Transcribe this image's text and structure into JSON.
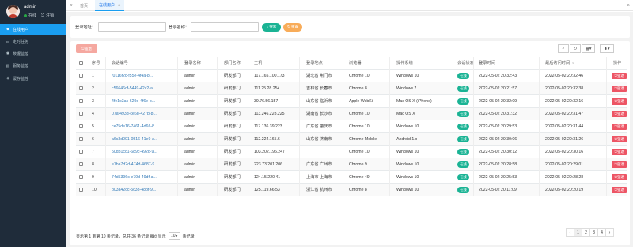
{
  "user": {
    "name": "admin",
    "status": "在线",
    "logout": "注销"
  },
  "sidebar": {
    "items": [
      {
        "label": "在线用户",
        "icon": "user-icon"
      },
      {
        "label": "定时任务",
        "icon": "tasks-icon"
      },
      {
        "label": "数据监控",
        "icon": "bug-icon"
      },
      {
        "label": "服务监控",
        "icon": "server-icon"
      },
      {
        "label": "缓存监控",
        "icon": "cube-icon"
      }
    ]
  },
  "tabs": {
    "home": "首页",
    "active": "在线用户"
  },
  "search": {
    "ip_label": "登录地址：",
    "name_label": "登录名称：",
    "search_btn": "搜索",
    "reset_btn": "重置"
  },
  "toolbar": {
    "kick_btn": "强退"
  },
  "table": {
    "headers": {
      "index": "序号",
      "session": "会话编号",
      "login_name": "登录名称",
      "dept": "部门名称",
      "host": "主机",
      "location": "登录地点",
      "browser": "浏览器",
      "os": "操作系统",
      "status": "会话状态",
      "login_time": "登录时间",
      "last_access": "最后访问时间",
      "action": "操作"
    },
    "rows": [
      {
        "index": "1",
        "session": "f0116f2c-f55e-4f4a-8...",
        "login_name": "admin",
        "dept": "研发部门",
        "host": "117.165.100.173",
        "location": "湖北省 荆门市",
        "browser": "Chrome 10",
        "os": "Windows 10",
        "status": "在线",
        "login_time": "2022-05-02 20:32:43",
        "last_access": "2022-05-02 20:32:46",
        "action": "强退"
      },
      {
        "index": "2",
        "session": "c56646cf-5449-42c2-a...",
        "login_name": "admin",
        "dept": "研发部门",
        "host": "111.25.28.254",
        "location": "吉林省 长春市",
        "browser": "Chrome 8",
        "os": "Windows 7",
        "status": "在线",
        "login_time": "2022-05-02 20:21:57",
        "last_access": "2022-05-02 20:32:38",
        "action": "强退"
      },
      {
        "index": "3",
        "session": "4fe1c3ac-629d-4f6e-b...",
        "login_name": "admin",
        "dept": "研发部门",
        "host": "39.76.56.157",
        "location": "山东省 临沂市",
        "browser": "Apple WebKit",
        "os": "Mac OS X (iPhone)",
        "status": "在线",
        "login_time": "2022-05-02 20:32:09",
        "last_access": "2022-05-02 20:32:16",
        "action": "强退"
      },
      {
        "index": "4",
        "session": "07af493d-ce6d-427b-8...",
        "login_name": "admin",
        "dept": "研发部门",
        "host": "113.246.228.225",
        "location": "湖南省 长沙市",
        "browser": "Chrome 10",
        "os": "Mac OS X",
        "status": "在线",
        "login_time": "2022-05-02 20:31:32",
        "last_access": "2022-05-02 20:31:47",
        "action": "强退"
      },
      {
        "index": "5",
        "session": "ce75de16-7461-4d66-8...",
        "login_name": "admin",
        "dept": "研发部门",
        "host": "117.136.39.223",
        "location": "广东省 肇庆市",
        "browser": "Chrome 10",
        "os": "Windows 10",
        "status": "在线",
        "login_time": "2022-05-02 20:29:53",
        "last_access": "2022-05-02 20:31:44",
        "action": "强退"
      },
      {
        "index": "6",
        "session": "a6c3d001-0516-41e9-a...",
        "login_name": "admin",
        "dept": "研发部门",
        "host": "112.224.165.6",
        "location": "山东省 济南市",
        "browser": "Chrome Mobile",
        "os": "Android 1.x",
        "status": "在线",
        "login_time": "2022-05-02 20:30:06",
        "last_access": "2022-05-02 20:31:26",
        "action": "强退"
      },
      {
        "index": "7",
        "session": "50db1cc1-689c-492d-9...",
        "login_name": "admin",
        "dept": "研发部门",
        "host": "103.202.196.247",
        "location": "",
        "browser": "Chrome 10",
        "os": "Windows 10",
        "status": "在线",
        "login_time": "2022-05-02 20:30:12",
        "last_access": "2022-05-02 20:30:16",
        "action": "强退"
      },
      {
        "index": "8",
        "session": "e7ba7d2d-474d-4687-9...",
        "login_name": "admin",
        "dept": "研发部门",
        "host": "223.73.201.206",
        "location": "广东省 广州市",
        "browser": "Chrome 9",
        "os": "Windows 10",
        "status": "在线",
        "login_time": "2022-05-02 20:28:58",
        "last_access": "2022-05-02 20:29:01",
        "action": "强退"
      },
      {
        "index": "9",
        "session": "74d5396c-e79d-49df-a...",
        "login_name": "admin",
        "dept": "研发部门",
        "host": "124.15.220.41",
        "location": "上海市 上海市",
        "browser": "Chrome 49",
        "os": "Windows 10",
        "status": "在线",
        "login_time": "2022-05-02 20:25:53",
        "last_access": "2022-05-02 20:28:28",
        "action": "强退"
      },
      {
        "index": "10",
        "session": "b03a42cc-5c38-48bf-9...",
        "login_name": "admin",
        "dept": "研发部门",
        "host": "125.119.66.53",
        "location": "浙江省 杭州市",
        "browser": "Chrome 8",
        "os": "Windows 10",
        "status": "在线",
        "login_time": "2022-05-02 20:11:09",
        "last_access": "2022-05-02 20:20:19",
        "action": "强退"
      }
    ]
  },
  "footer": {
    "summary_prefix": "显示第 1 到第 10 条记录，总共 36 条记录 每页显示",
    "page_size": "10",
    "summary_suffix": "条记录"
  },
  "pagination": {
    "prev": "‹",
    "pages": [
      "1",
      "2",
      "3",
      "4"
    ],
    "next": "›"
  },
  "colors": {
    "sidebar_bg": "#1f2c3a",
    "accent": "#1a9ef0",
    "success": "#1ab394",
    "warning": "#f8ac59",
    "danger": "#ed5565"
  }
}
